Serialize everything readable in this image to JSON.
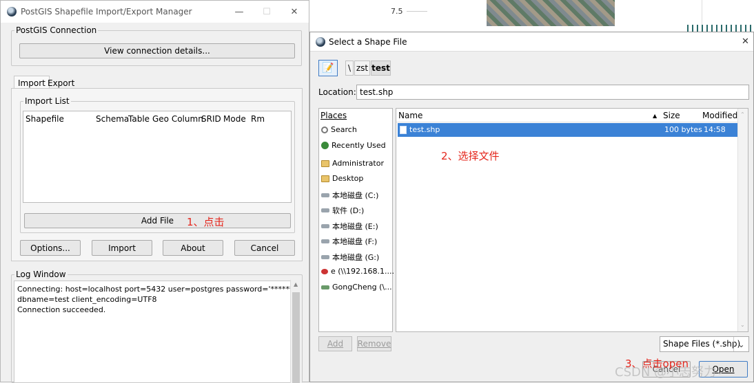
{
  "background": {
    "tick_value": "7.5"
  },
  "main_window": {
    "title": "PostGIS Shapefile Import/Export Manager",
    "connection_group": "PostGIS Connection",
    "view_connection_button": "View connection details...",
    "tabs": [
      "Import",
      "Export"
    ],
    "import_list_group": "Import List",
    "columns": [
      "Shapefile",
      "Schema",
      "Table",
      "Geo Column",
      "SRID",
      "Mode",
      "Rm"
    ],
    "add_file_button": "Add File",
    "buttons": {
      "options": "Options...",
      "import": "Import",
      "about": "About",
      "cancel": "Cancel"
    },
    "log_group": "Log Window",
    "log_lines": [
      "Connecting:  host=localhost port=5432 user=postgres password='******'",
      "dbname=test client_encoding=UTF8",
      "Connection succeeded."
    ]
  },
  "annotations": {
    "step1": "1、点击",
    "step2": "2、选择文件",
    "step3": "3、点击open"
  },
  "dialog": {
    "title": "Select a Shape File",
    "path": {
      "root": "\\",
      "dir": "zst",
      "current": "test"
    },
    "location_label": "Location:",
    "location_value": "test.shp",
    "places_header": "Places",
    "places": [
      {
        "label": "Search",
        "icon": "search-icon"
      },
      {
        "label": "Recently Used",
        "icon": "clock-icon"
      },
      {
        "label": "Administrator",
        "icon": "folder-icon"
      },
      {
        "label": "Desktop",
        "icon": "folder-icon"
      },
      {
        "label": "本地磁盘 (C:)",
        "icon": "drive-icon"
      },
      {
        "label": "软件 (D:)",
        "icon": "drive-icon"
      },
      {
        "label": "本地磁盘 (E:)",
        "icon": "drive-icon"
      },
      {
        "label": "本地磁盘 (F:)",
        "icon": "drive-icon"
      },
      {
        "label": "本地磁盘 (G:)",
        "icon": "drive-icon"
      },
      {
        "label": "e (\\\\192.168.1....",
        "icon": "network-drive-icon"
      },
      {
        "label": "GongCheng (\\...",
        "icon": "network-drive-icon"
      }
    ],
    "file_columns": {
      "name": "Name",
      "size": "Size",
      "modified": "Modified"
    },
    "files": [
      {
        "name": "test.shp",
        "size": "100 bytes",
        "modified": "14:58"
      }
    ],
    "add_button": "Add",
    "remove_button": "Remove",
    "filter": "Shape Files (*.shp)",
    "cancel_button": "Cancel",
    "open_button": "Open"
  },
  "watermark": "CSDN @小志努力"
}
